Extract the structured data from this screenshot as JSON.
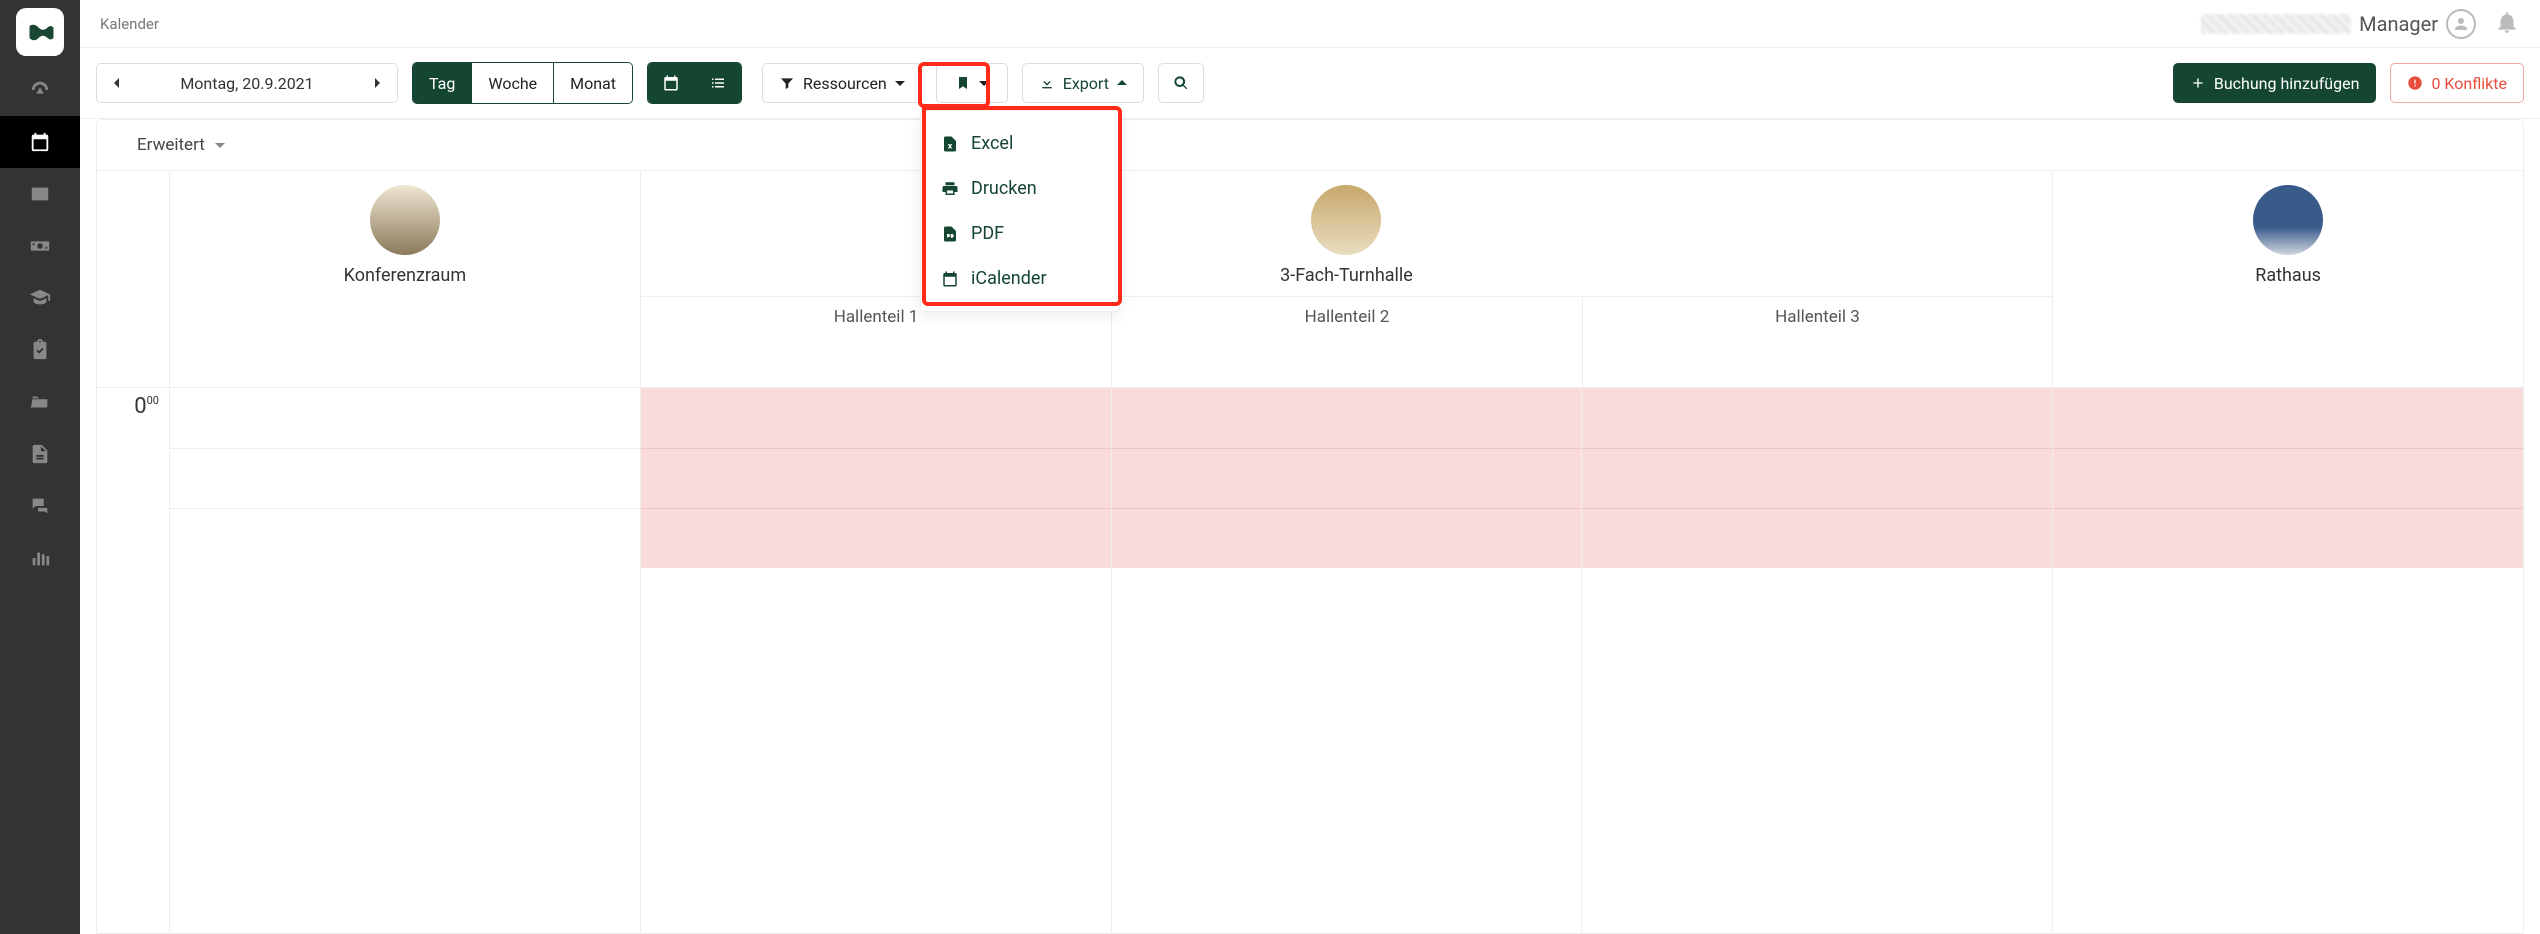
{
  "header": {
    "title": "Kalender",
    "role": "Manager"
  },
  "toolbar": {
    "date_label": "Montag, 20.9.2021",
    "view_tag": "Tag",
    "view_week": "Woche",
    "view_month": "Monat",
    "resources_label": "Ressourcen",
    "export_label": "Export",
    "add_booking": "Buchung hinzufügen",
    "conflicts": "0 Konflikte"
  },
  "subbar": {
    "erweitert": "Erweitert"
  },
  "export_menu": {
    "excel": "Excel",
    "print": "Drucken",
    "pdf": "PDF",
    "ical": "iCalender"
  },
  "resources": {
    "konferenzraum": "Konferenzraum",
    "turnhalle": "3-Fach-Turnhalle",
    "hallenteil1": "Hallenteil 1",
    "hallenteil2": "Hallenteil 2",
    "hallenteil3": "Hallenteil 3",
    "rathaus": "Rathaus"
  },
  "time": {
    "h0": "0",
    "m0": "00"
  }
}
